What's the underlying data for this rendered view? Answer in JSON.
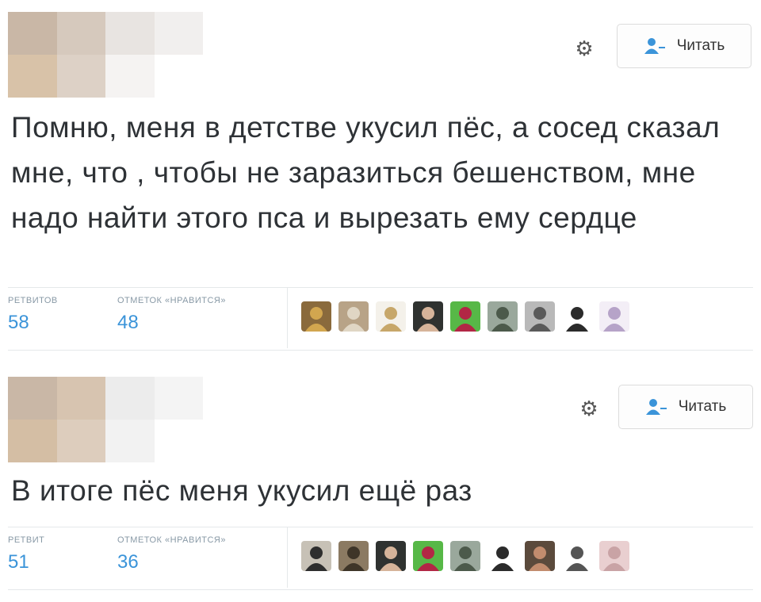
{
  "tweets": [
    {
      "text": "Помню, меня в детстве укусил пёс, а сосед сказал мне, что , чтобы не заразиться бешенством, мне надо найти этого пса и вырезать ему сердце",
      "follow_label": "Читать",
      "gear_icon": "gear-icon",
      "stats": [
        {
          "label": "РЕТВИТОВ",
          "count": "58"
        },
        {
          "label": "ОТМЕТОК «НРАВИТСЯ»",
          "count": "48"
        }
      ],
      "avatar_colors": [
        "#c9b7a6",
        "#d6c9bd",
        "#e8e4e1",
        "#f1efee",
        "#d8c2a8",
        "#ddd1c6",
        "#f5f3f2",
        "#ffffff"
      ],
      "liker_avatars": [
        {
          "icon": "meme-face-avatar",
          "bg": "#8a6a3c",
          "fg": "#d2a64f"
        },
        {
          "icon": "painting-avatar",
          "bg": "#b8a387",
          "fg": "#e0d6c4"
        },
        {
          "icon": "cartoon-avatar",
          "bg": "#f4f1ea",
          "fg": "#c7a76a"
        },
        {
          "icon": "plague-mask-avatar",
          "bg": "#2f3230",
          "fg": "#d6b49a"
        },
        {
          "icon": "red-pattern-avatar",
          "bg": "#57b847",
          "fg": "#b22745"
        },
        {
          "icon": "group-photo-avatar",
          "bg": "#9aa89c",
          "fg": "#4c5a4b"
        },
        {
          "icon": "portrait-avatar",
          "bg": "#b9b9b9",
          "fg": "#5a5a5a"
        },
        {
          "icon": "silhouette-avatar",
          "bg": "#ffffff",
          "fg": "#2b2b2b"
        },
        {
          "icon": "blob-avatar",
          "bg": "#f3eef6",
          "fg": "#b6a3c8"
        }
      ]
    },
    {
      "text": "В итоге пёс меня укусил ещё раз",
      "follow_label": "Читать",
      "gear_icon": "gear-icon",
      "stats": [
        {
          "label": "РЕТВИТ",
          "count": "51"
        },
        {
          "label": "ОТМЕТОК «НРАВИТСЯ»",
          "count": "36"
        }
      ],
      "avatar_colors": [
        "#c9b7a6",
        "#d7c4b0",
        "#ececec",
        "#f4f4f4",
        "#d4bea4",
        "#ddcdbd",
        "#f2f2f2",
        "#ffffff"
      ],
      "liker_avatars": [
        {
          "icon": "photo-avatar",
          "bg": "#c7c1b6",
          "fg": "#2e2e2e"
        },
        {
          "icon": "painting-avatar",
          "bg": "#8b7a62",
          "fg": "#3e3528"
        },
        {
          "icon": "plague-mask-avatar",
          "bg": "#2f3230",
          "fg": "#d6b49a"
        },
        {
          "icon": "red-pattern-avatar",
          "bg": "#57b847",
          "fg": "#b22745"
        },
        {
          "icon": "group-photo-avatar",
          "bg": "#9aa89c",
          "fg": "#4c5a4b"
        },
        {
          "icon": "silhouette-avatar",
          "bg": "#ffffff",
          "fg": "#2b2b2b"
        },
        {
          "icon": "face-photo-avatar",
          "bg": "#5b4a3c",
          "fg": "#c28c6e"
        },
        {
          "icon": "sketch-avatar",
          "bg": "#ffffff",
          "fg": "#555555"
        },
        {
          "icon": "pink-photo-avatar",
          "bg": "#e9cfd0",
          "fg": "#c9a3a5"
        }
      ]
    }
  ]
}
